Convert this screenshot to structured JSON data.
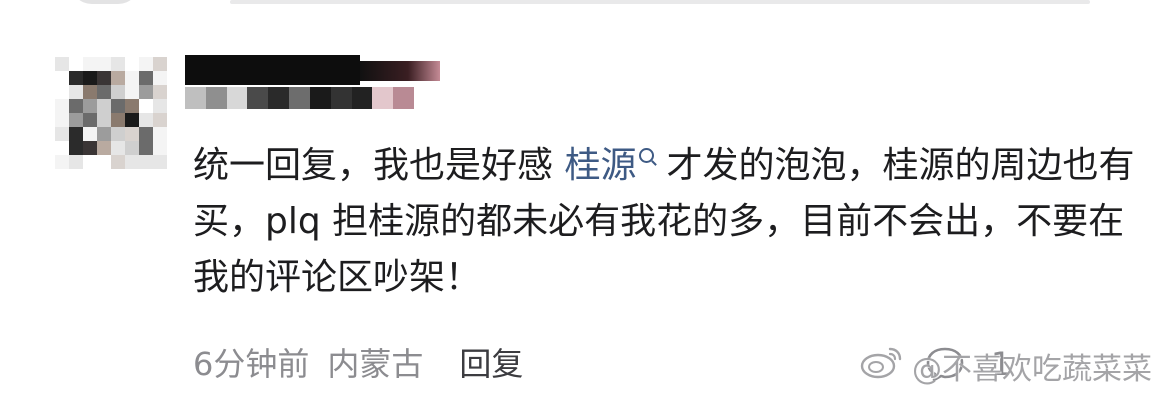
{
  "comment": {
    "text_before_link": "统一回复，我也是好感 ",
    "link_text": "桂源",
    "text_after_link": "才发的泡泡，桂源的周边也有买，plq 担桂源的都未必有我花的多，目前不会出，不要在我的评论区吵架！"
  },
  "meta": {
    "time": "6分钟前",
    "location": "内蒙古",
    "reply_label": "回复"
  },
  "actions": {
    "like_count": "1"
  },
  "watermark": {
    "text": "@不喜欢吃蔬菜菜"
  },
  "colors": {
    "text": "#1d1d1f",
    "link": "#3e5a84",
    "meta": "#8c8c90"
  }
}
